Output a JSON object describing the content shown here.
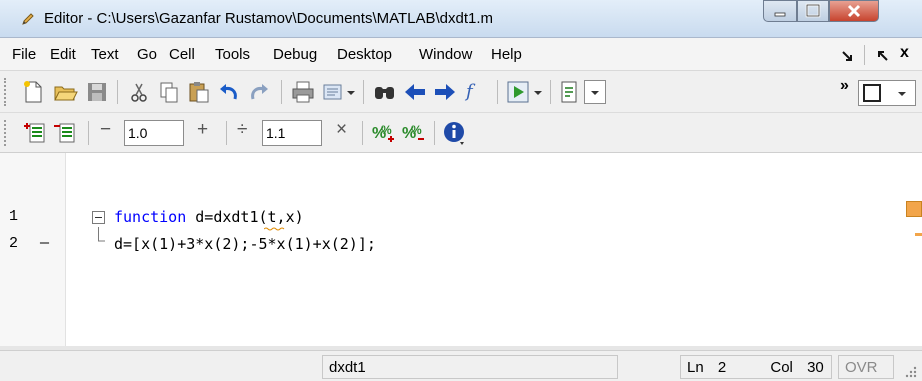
{
  "window": {
    "title": "Editor - C:\\Users\\Gazanfar Rustamov\\Documents\\MATLAB\\dxdt1.m",
    "minimize_icon": "minimize-icon",
    "maximize_icon": "maximize-icon",
    "close_icon": "close-icon"
  },
  "menu": {
    "items": [
      "File",
      "Edit",
      "Text",
      "Go",
      "Cell",
      "Tools",
      "Debug",
      "Desktop",
      "Window",
      "Help"
    ],
    "right_icons": [
      "dock-arrow-icon",
      "undock-arrow-icon",
      "close-x-icon"
    ],
    "x_label": "x"
  },
  "toolbar1": {
    "buttons": [
      "new-file-icon",
      "open-folder-icon",
      "save-icon",
      "cut-icon",
      "copy-icon",
      "paste-icon",
      "undo-icon",
      "redo-icon",
      "print-icon",
      "insert-cell-icon",
      "find-icon",
      "back-arrow-icon",
      "forward-arrow-icon",
      "fx-icon",
      "run-icon",
      "page-icon",
      "overflow-chevron-icon",
      "layout-box-icon"
    ],
    "fx_label": "f",
    "overflow_label": "»"
  },
  "toolbar2": {
    "minus_label": "−",
    "value1": "1.0",
    "plus_label": "+",
    "divide_label": "÷",
    "value2": "1.1",
    "times_label": "×",
    "icons": [
      "cell-insert-icon",
      "cell-remove-icon",
      "comment-percent-icon",
      "uncomment-percent-icon",
      "info-icon"
    ]
  },
  "editor": {
    "lines": [
      {
        "number": "1",
        "marker": "",
        "keyword": "function",
        "rest": " d=dxdt1(t,x)"
      },
      {
        "number": "2",
        "marker": "—",
        "keyword": "",
        "rest": "d=[x(1)+3*x(2);-5*x(1)+x(2)];"
      }
    ]
  },
  "status": {
    "function_name": "dxdt1",
    "ln_label": "Ln",
    "ln_value": "2",
    "col_label": "Col",
    "col_value": "30",
    "ovr": "OVR"
  }
}
